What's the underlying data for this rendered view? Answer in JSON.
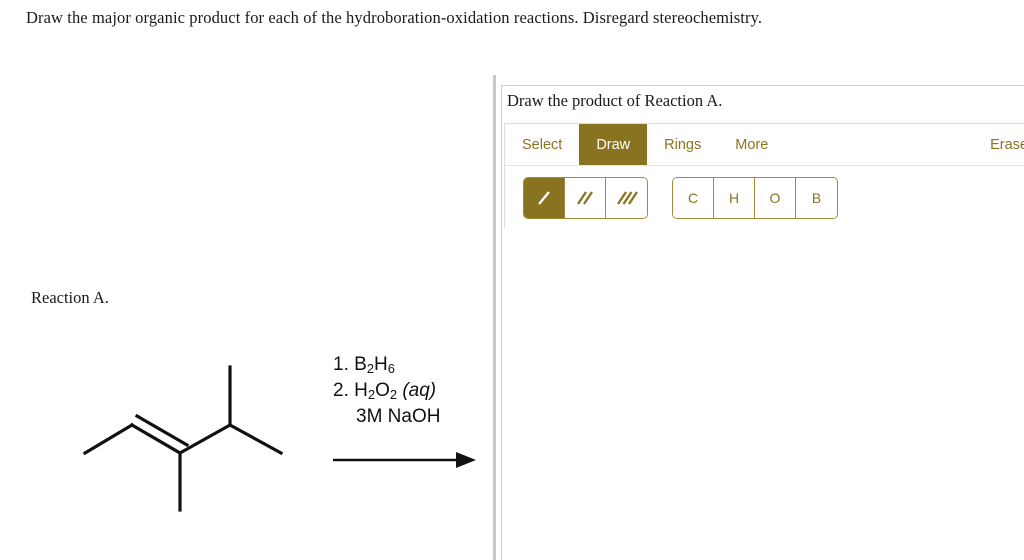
{
  "question": {
    "prompt": "Draw the major organic product for each of the hydroboration-oxidation reactions. Disregard stereochemistry."
  },
  "reaction": {
    "label": "Reaction A.",
    "reagents": {
      "step1_number": "1.",
      "step1_formula_pre": "B",
      "step1_sub1": "2",
      "step1_mid": "H",
      "step1_sub2": "6",
      "step2_number": "2.",
      "step2_formula_pre": "H",
      "step2_sub1": "2",
      "step2_mid": "O",
      "step2_sub2": "2",
      "step2_state": "(aq)",
      "step3": "3M NaOH"
    },
    "structure_name": "3,4-dimethyl-2-pentene",
    "arrow": "reaction-arrow"
  },
  "panel": {
    "title": "Draw the product of Reaction A.",
    "accent_color": "#8a7320",
    "border_color": "#a08c3a",
    "tabs": [
      {
        "label": "Select",
        "active": false
      },
      {
        "label": "Draw",
        "active": true
      },
      {
        "label": "Rings",
        "active": false
      },
      {
        "label": "More",
        "active": false
      }
    ],
    "erase_label": "Erase",
    "bond_tools": [
      {
        "name": "single-bond",
        "active": true
      },
      {
        "name": "double-bond",
        "active": false
      },
      {
        "name": "triple-bond",
        "active": false
      }
    ],
    "element_buttons": [
      {
        "label": "C"
      },
      {
        "label": "H"
      },
      {
        "label": "O"
      },
      {
        "label": "B"
      }
    ]
  }
}
